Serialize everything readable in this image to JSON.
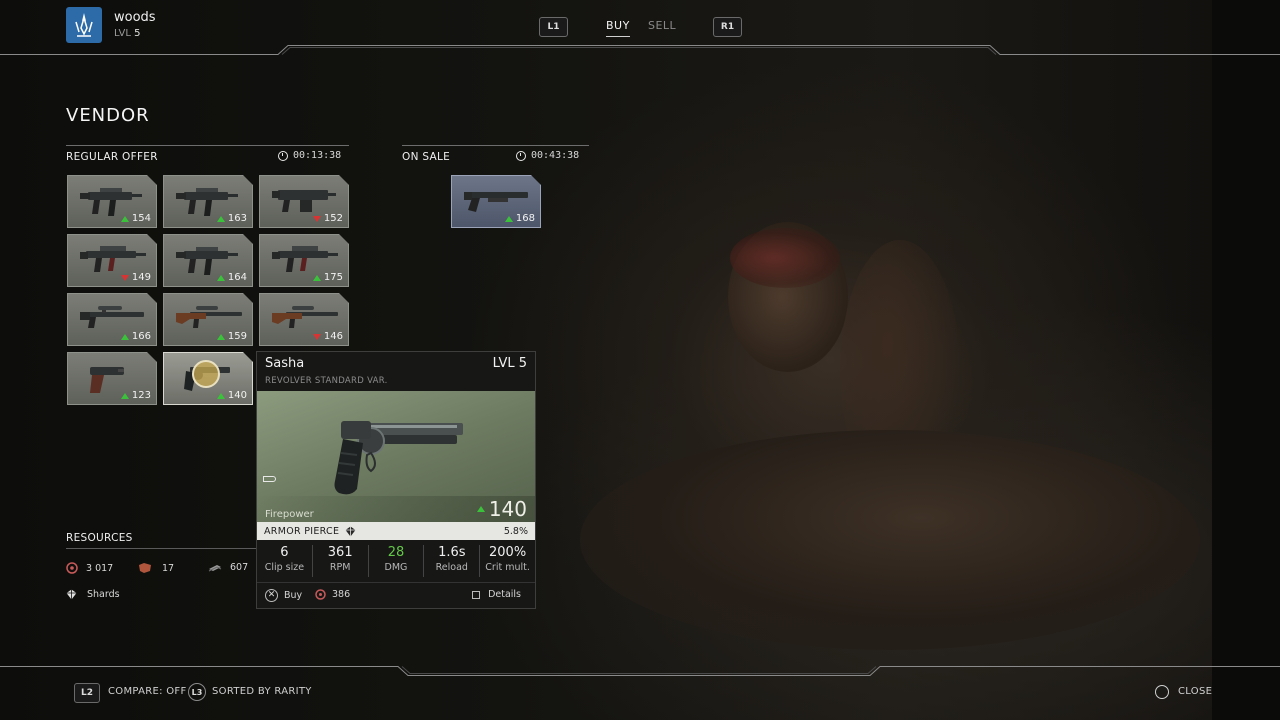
{
  "user": {
    "name": "woods",
    "level_prefix": "LVL",
    "level": "5"
  },
  "nav": {
    "left_key": "L1",
    "right_key": "R1",
    "tabs": [
      {
        "label": "BUY",
        "active": true
      },
      {
        "label": "SELL",
        "active": false
      }
    ]
  },
  "page_title": "VENDOR",
  "regular_offer": {
    "label": "REGULAR OFFER",
    "timer": "00:13:38",
    "items": [
      {
        "power": "154",
        "trend": "up",
        "kind": "smg"
      },
      {
        "power": "163",
        "trend": "up",
        "kind": "smg"
      },
      {
        "power": "152",
        "trend": "down",
        "kind": "lmg"
      },
      {
        "power": "149",
        "trend": "down",
        "kind": "rifle"
      },
      {
        "power": "164",
        "trend": "up",
        "kind": "smg"
      },
      {
        "power": "175",
        "trend": "up",
        "kind": "rifle"
      },
      {
        "power": "166",
        "trend": "up",
        "kind": "sniper"
      },
      {
        "power": "159",
        "trend": "up",
        "kind": "sniper-wood"
      },
      {
        "power": "146",
        "trend": "down",
        "kind": "sniper-wood"
      },
      {
        "power": "123",
        "trend": "up",
        "kind": "pistol"
      },
      {
        "power": "140",
        "trend": "up",
        "kind": "revolver",
        "selected": true
      }
    ]
  },
  "on_sale": {
    "label": "ON SALE",
    "timer": "00:43:38",
    "items": [
      {
        "power": "168",
        "trend": "up",
        "kind": "shotgun"
      }
    ]
  },
  "detail": {
    "name": "Sasha",
    "level": "LVL 5",
    "type": "REVOLVER STANDARD VAR.",
    "firepower_label": "Firepower",
    "firepower": "140",
    "perk_name": "ARMOR PIERCE",
    "perk_value": "5.8%",
    "stats": [
      {
        "value": "6",
        "label": "Clip size"
      },
      {
        "value": "361",
        "label": "RPM"
      },
      {
        "value": "28",
        "label": "DMG",
        "highlight": true
      },
      {
        "value": "1.6s",
        "label": "Reload"
      },
      {
        "value": "200%",
        "label": "Crit mult."
      }
    ],
    "buy_label": "Buy",
    "price": "386",
    "details_label": "Details"
  },
  "resources": {
    "label": "RESOURCES",
    "credits": "3 017",
    "materials": "17",
    "scrap": "607",
    "shards_label": "Shards"
  },
  "bottom_bar": {
    "compare_key": "L2",
    "compare_label": "COMPARE: OFF",
    "sort_key": "L3",
    "sort_label": "SORTED BY RARITY",
    "close_label": "CLOSE"
  },
  "colors": {
    "up": "#3bc23b",
    "down": "#d93434",
    "dmg_highlight": "#63c748",
    "avatar": "#2c6aa8"
  }
}
